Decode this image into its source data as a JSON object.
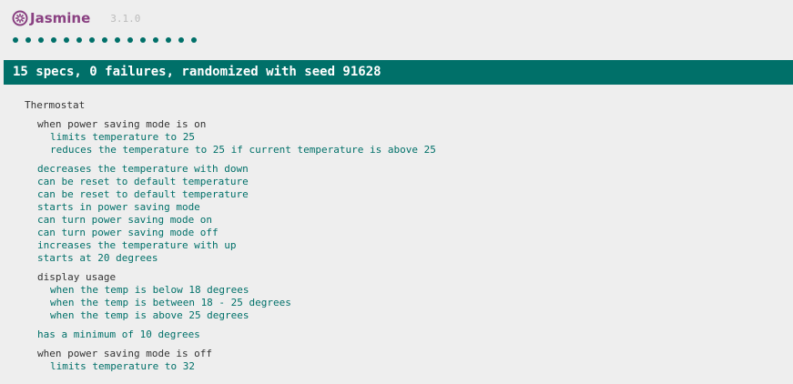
{
  "header": {
    "logo_text": "Jasmine",
    "version": "3.1.0",
    "passed_dots": 15
  },
  "colors": {
    "passed": "#007069",
    "logo": "#8a4182"
  },
  "summary": "15 specs, 0 failures, randomized with seed 91628",
  "root": {
    "title": "Thermostat",
    "group1": {
      "title": "when power saving mode is on",
      "specs": [
        "limits temperature to 25",
        "reduces the temperature to 25 if current temperature is above 25"
      ]
    },
    "specs1": [
      "decreases the temperature with down",
      "can be reset to default temperature",
      "can be reset to default temperature",
      "starts in power saving mode",
      "can turn power saving mode on",
      "can turn power saving mode off",
      "increases the temperature with up",
      "starts at 20 degrees"
    ],
    "group2": {
      "title": "display usage",
      "specs": [
        "when the temp is below 18 degrees",
        "when the temp is between 18 - 25 degrees",
        "when the temp is above 25 degrees"
      ]
    },
    "specs2": [
      "has a minimum of 10 degrees"
    ],
    "group3": {
      "title": "when power saving mode is off",
      "specs": [
        "limits temperature to 32"
      ]
    }
  }
}
